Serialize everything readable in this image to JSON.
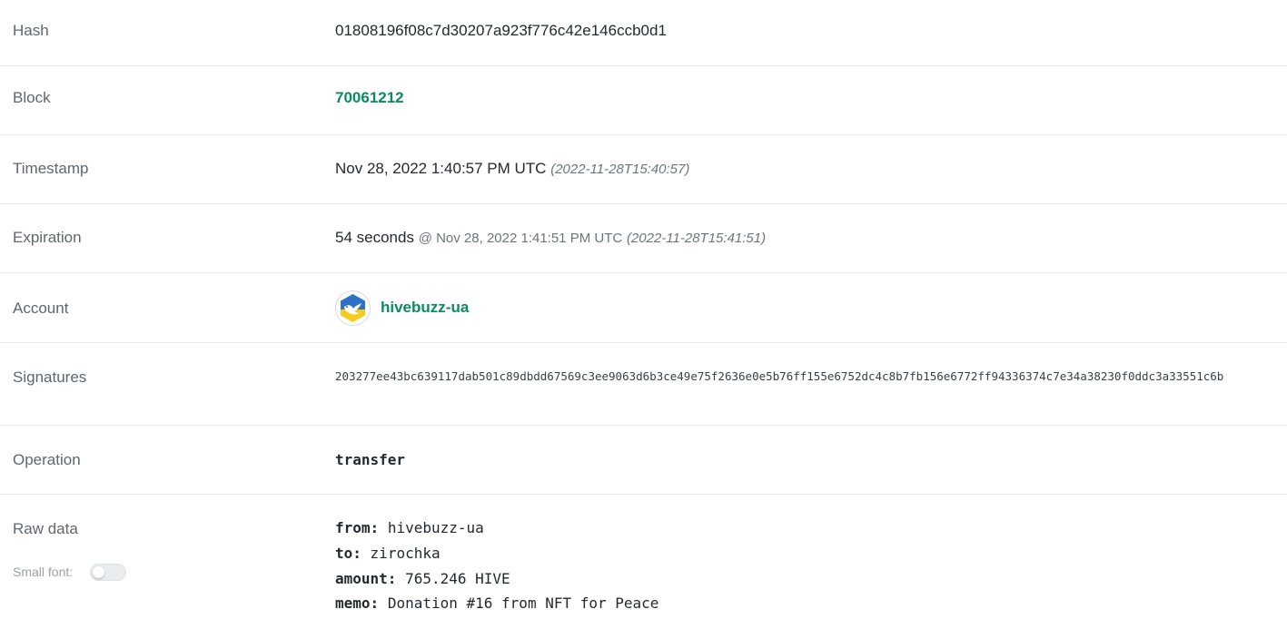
{
  "rows": {
    "hash": {
      "label": "Hash",
      "value": "01808196f08c7d30207a923f776c42e146ccb0d1"
    },
    "block": {
      "label": "Block",
      "value": "70061212"
    },
    "timestamp": {
      "label": "Timestamp",
      "value": "Nov 28, 2022 1:40:57 PM UTC",
      "iso": "(2022-11-28T15:40:57)"
    },
    "expiration": {
      "label": "Expiration",
      "duration": "54 seconds",
      "at": "@ Nov 28, 2022 1:41:51 PM UTC",
      "iso": "(2022-11-28T15:41:51)"
    },
    "account": {
      "label": "Account",
      "name": "hivebuzz-ua"
    },
    "signatures": {
      "label": "Signatures",
      "value": "203277ee43bc639117dab501c89dbdd67569c3ee9063d6b3ce49e75f2636e0e5b76ff155e6752dc4c8b7fb156e6772ff94336374c7e34a38230f0ddc3a33551c6b"
    },
    "operation": {
      "label": "Operation",
      "value": "transfer"
    },
    "raw": {
      "label": "Raw data",
      "small_font_label": "Small font:",
      "small_font_enabled": false,
      "fields": {
        "from": {
          "key": "from",
          "value": "hivebuzz-ua"
        },
        "to": {
          "key": "to",
          "value": "zirochka"
        },
        "amount": {
          "key": "amount",
          "value": "765.246 HIVE"
        },
        "memo": {
          "key": "memo",
          "value": "Donation #16 from NFT for Peace"
        }
      }
    }
  },
  "colors": {
    "link_green": "#0b8a63",
    "label_gray": "#5f6670",
    "divider": "#e6e8eb"
  },
  "icons": {
    "account_avatar": "dove-ukraine-avatar-icon"
  }
}
